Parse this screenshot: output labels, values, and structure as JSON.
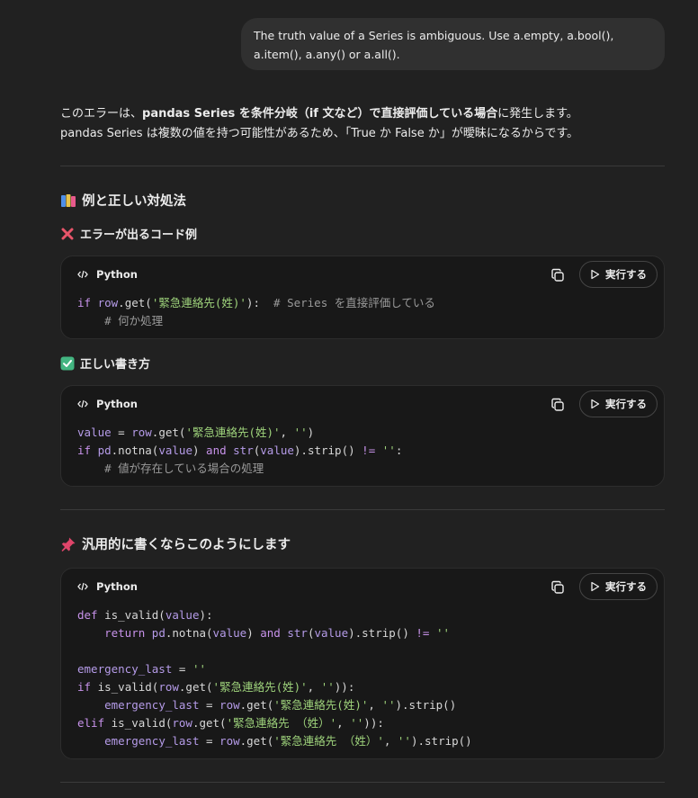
{
  "user_message": "The truth value of a Series is ambiguous. Use a.empty, a.bool(), a.item(), a.any() or a.all().",
  "intro": {
    "line1_pre": "このエラーは、",
    "line1_bold1": "pandas Series を条件分岐（if 文など）で直接評価している場合",
    "line1_post": "に発生します。",
    "line2": "pandas Series は複数の値を持つ可能性があるため、「True か False か」が曖昧になるからです。"
  },
  "section1": {
    "heading": "例と正しい対処法",
    "icon": "books-icon",
    "error_heading": "エラーが出るコード例",
    "correct_heading": "正しい書き方"
  },
  "section2": {
    "heading": "汎用的に書くならこのようにします",
    "icon": "pushpin-icon"
  },
  "code_block": {
    "language": "Python",
    "run_label": "実行する"
  },
  "code1": {
    "l1_kw": "if",
    "l1_var": "row",
    "l1_a": ".get(",
    "l1_str": "'緊急連絡先(姓)'",
    "l1_b": "):  ",
    "l1_cmt": "# Series を直接評価している",
    "l2_cmt": "# 何か処理"
  },
  "code2": {
    "l1_var": "value",
    "l1_a": " = ",
    "l1_row": "row",
    "l1_b": ".get(",
    "l1_str1": "'緊急連絡先(姓)'",
    "l1_c": ", ",
    "l1_str2": "''",
    "l1_d": ")",
    "l2_kw": "if",
    "l2_pd": "pd",
    "l2_a": ".notna(",
    "l2_value": "value",
    "l2_b": ") ",
    "l2_and": "and",
    "l2_str_fn": "str",
    "l2_c": "(",
    "l2_value2": "value",
    "l2_d": ").strip() ",
    "l2_ne": "!=",
    "l2_e": " ",
    "l2_empty": "''",
    "l2_f": ":",
    "l3_cmt": "# 値が存在している場合の処理"
  },
  "code3": {
    "l1_def": "def",
    "l1_a": " is_valid(",
    "l1_value": "value",
    "l1_b": "):",
    "l2_return": "return",
    "l2_pd": "pd",
    "l2_a": ".notna(",
    "l2_value": "value",
    "l2_b": ") ",
    "l2_and": "and",
    "l2_str_fn": "str",
    "l2_c": "(",
    "l2_value2": "value",
    "l2_d": ").strip() ",
    "l2_ne": "!=",
    "l2_e": " ",
    "l2_empty": "''",
    "l4_var": "emergency_last",
    "l4_a": " = ",
    "l4_empty": "''",
    "l5_kw": "if",
    "l5_a": " is_valid(",
    "l5_row": "row",
    "l5_b": ".get(",
    "l5_str": "'緊急連絡先(姓)'",
    "l5_c": ", ",
    "l5_empty": "''",
    "l5_d": ")):",
    "l6_var": "emergency_last",
    "l6_a": " = ",
    "l6_row": "row",
    "l6_b": ".get(",
    "l6_str": "'緊急連絡先(姓)'",
    "l6_c": ", ",
    "l6_empty": "''",
    "l6_d": ").strip()",
    "l7_kw": "elif",
    "l7_a": " is_valid(",
    "l7_row": "row",
    "l7_b": ".get(",
    "l7_str": "'緊急連絡先 （姓）'",
    "l7_c": ", ",
    "l7_empty": "''",
    "l7_d": ")):",
    "l8_var": "emergency_last",
    "l8_a": " = ",
    "l8_row": "row",
    "l8_b": ".get(",
    "l8_str": "'緊急連絡先 （姓）'",
    "l8_c": ", ",
    "l8_empty": "''",
    "l8_d": ").strip()"
  },
  "colors": {
    "background": "#212121",
    "bubble": "#303030",
    "code_bg": "#181818",
    "keyword": "#c792ea",
    "string": "#9fd47c",
    "comment": "#9a9a9a",
    "error_mark": "#e8556a",
    "check_mark": "#43b581",
    "pushpin": "#e0456a"
  }
}
